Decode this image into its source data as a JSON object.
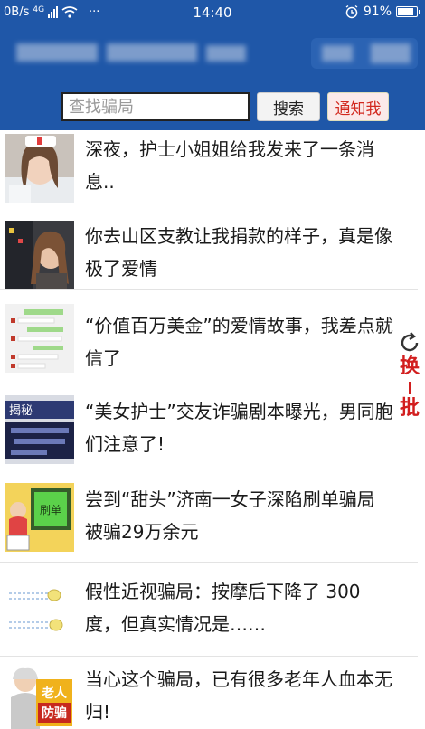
{
  "status_bar": {
    "net_speed": "0B/s",
    "network": "4G",
    "overflow": "···",
    "time": "14:40",
    "alarm_icon": "alarm-icon",
    "battery": "91%",
    "battery_level": 0.91
  },
  "header": {
    "search": {
      "placeholder": "查找骗局",
      "value": ""
    },
    "search_button": "搜索",
    "notify_button": "通知我"
  },
  "refresh": {
    "top": "换",
    "bottom": "批"
  },
  "articles": [
    {
      "title": "深夜，护士小姐姐给我发来了一条消息..",
      "thumb": "nurse-photo"
    },
    {
      "title": "你去山区支教让我捐款的样子，真是像极了爱情",
      "thumb": "woman-photo"
    },
    {
      "title": "“价值百万美金”的爱情故事，我差点就信了",
      "thumb": "chat-screenshot"
    },
    {
      "title": "“美女护士”交友诈骗剧本曝光，男同胞们注意了!",
      "thumb": "news-banner"
    },
    {
      "title": "尝到“甜头”济南一女子深陷刷单骗局 被骗29万余元",
      "thumb": "cartoon-scam"
    },
    {
      "title": "假性近视骗局：按摩后下降了 300 度，但真实情况是……",
      "thumb": "diagram"
    },
    {
      "title": "当心这个骗局，已有很多老年人血本无归!",
      "thumb": "elderly-scam"
    }
  ],
  "thumb_labels": {
    "banner": "揭秘",
    "screen": "刷单",
    "elder_top": "老人",
    "elder_bottom": "防骗"
  }
}
